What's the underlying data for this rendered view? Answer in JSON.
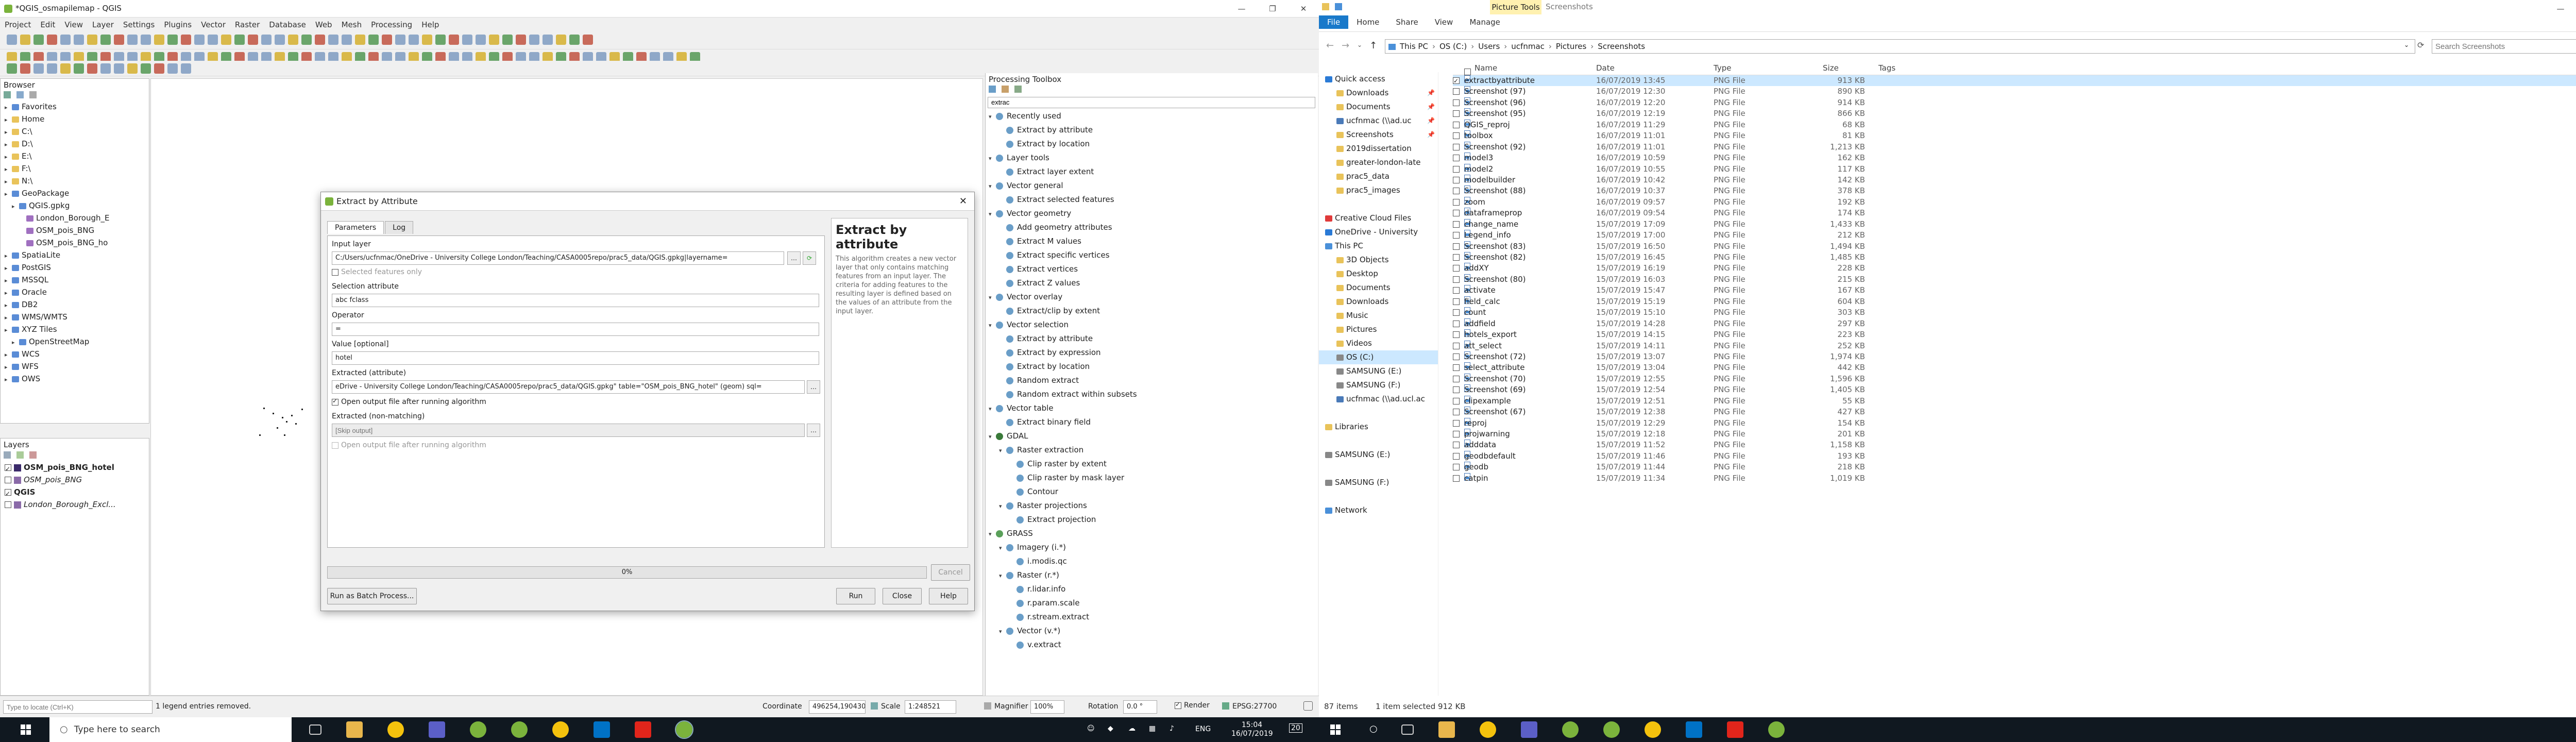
{
  "qgis": {
    "title": "*QGIS_osmapilemap - QGIS",
    "menu": [
      "Project",
      "Edit",
      "View",
      "Layer",
      "Settings",
      "Plugins",
      "Vector",
      "Raster",
      "Database",
      "Web",
      "Mesh",
      "Processing",
      "Help"
    ],
    "browser_title": "Browser",
    "browser_items": [
      {
        "label": "Favorites",
        "indent": 1,
        "icon": "star-icon"
      },
      {
        "label": "Home",
        "indent": 1,
        "icon": "folder-icon"
      },
      {
        "label": "C:\\",
        "indent": 1,
        "icon": "folder-icon"
      },
      {
        "label": "D:\\",
        "indent": 1,
        "icon": "folder-icon"
      },
      {
        "label": "E:\\",
        "indent": 1,
        "icon": "folder-icon"
      },
      {
        "label": "F:\\",
        "indent": 1,
        "icon": "folder-icon"
      },
      {
        "label": "N:\\",
        "indent": 1,
        "icon": "folder-icon"
      },
      {
        "label": "GeoPackage",
        "indent": 1,
        "icon": "geopackage-icon"
      },
      {
        "label": "QGIS.gpkg",
        "indent": 2,
        "icon": "geopackage-icon"
      },
      {
        "label": "London_Borough_E",
        "indent": 3,
        "icon": "polygon-layer-icon"
      },
      {
        "label": "OSM_pois_BNG",
        "indent": 3,
        "icon": "point-layer-icon"
      },
      {
        "label": "OSM_pois_BNG_ho",
        "indent": 3,
        "icon": "point-layer-icon"
      },
      {
        "label": "SpatiaLite",
        "indent": 1,
        "icon": "spatialite-icon"
      },
      {
        "label": "PostGIS",
        "indent": 1,
        "icon": "postgis-icon"
      },
      {
        "label": "MSSQL",
        "indent": 1,
        "icon": "mssql-icon"
      },
      {
        "label": "Oracle",
        "indent": 1,
        "icon": "oracle-icon"
      },
      {
        "label": "DB2",
        "indent": 1,
        "icon": "db2-icon"
      },
      {
        "label": "WMS/WMTS",
        "indent": 1,
        "icon": "wms-icon"
      },
      {
        "label": "XYZ Tiles",
        "indent": 1,
        "icon": "xyz-icon"
      },
      {
        "label": "OpenStreetMap",
        "indent": 2,
        "icon": "globe-icon"
      },
      {
        "label": "WCS",
        "indent": 1,
        "icon": "wcs-icon"
      },
      {
        "label": "WFS",
        "indent": 1,
        "icon": "wfs-icon"
      },
      {
        "label": "OWS",
        "indent": 1,
        "icon": "ows-icon"
      }
    ],
    "layers_title": "Layers",
    "layers": [
      {
        "label": "OSM_pois_BNG_hotel",
        "checked": true,
        "style": "bold"
      },
      {
        "label": "OSM_pois_BNG",
        "checked": false,
        "style": "italic"
      },
      {
        "label": "QGIS",
        "checked": true,
        "style": "bold-group"
      },
      {
        "label": "London_Borough_Excl...",
        "checked": false,
        "style": "italic"
      }
    ],
    "locate_placeholder": "Type to locate (Ctrl+K)",
    "status_message": "1 legend entries removed.",
    "coordinate_label": "Coordinate",
    "coordinate_value": "496254,190430",
    "scale_label": "Scale",
    "scale_value": "1:248521",
    "magnifier_label": "Magnifier",
    "magnifier_value": "100%",
    "rotation_label": "Rotation",
    "rotation_value": "0.0 °",
    "render_label": "Render",
    "crs": "EPSG:27700"
  },
  "dialog": {
    "title": "Extract by Attribute",
    "tabs": [
      "Parameters",
      "Log"
    ],
    "input_layer_label": "Input layer",
    "input_layer_value": "C:/Users/ucfnmac/OneDrive - University College London/Teaching/CASA0005repo/prac5_data/QGIS.gpkg|layername=",
    "selected_only_label": "Selected features only",
    "selection_attr_label": "Selection attribute",
    "selection_attr_value": "abc fclass",
    "operator_label": "Operator",
    "operator_value": "=",
    "value_label": "Value [optional]",
    "value_value": "hotel",
    "extracted_label": "Extracted (attribute)",
    "extracted_value": "eDrive - University College London/Teaching/CASA0005repo/prac5_data/QGIS.gpkg\" table=\"OSM_pois_BNG_hotel\" (geom) sql=",
    "open_after_label": "Open output file after running algorithm",
    "nonmatching_label": "Extracted (non-matching)",
    "nonmatching_placeholder": "[Skip output]",
    "open_after2_label": "Open output file after running algorithm",
    "progress_text": "0%",
    "progress": 0,
    "cancel": "Cancel",
    "batch": "Run as Batch Process...",
    "run": "Run",
    "close": "Close",
    "help": "Help",
    "help_title": "Extract by attribute",
    "help_text": "This algorithm creates a new vector layer that only contains matching features from an input layer. The criteria for adding features to the resulting layer is defined based on the values of an attribute from the input layer."
  },
  "toolbox": {
    "title": "Processing Toolbox",
    "search_value": "extrac",
    "items": [
      {
        "label": "Recently used",
        "level": 0,
        "type": "group"
      },
      {
        "label": "Extract by attribute",
        "level": 1,
        "type": "alg"
      },
      {
        "label": "Extract by location",
        "level": 1,
        "type": "alg"
      },
      {
        "label": "Layer tools",
        "level": 0,
        "type": "group"
      },
      {
        "label": "Extract layer extent",
        "level": 1,
        "type": "alg"
      },
      {
        "label": "Vector general",
        "level": 0,
        "type": "group"
      },
      {
        "label": "Extract selected features",
        "level": 1,
        "type": "alg"
      },
      {
        "label": "Vector geometry",
        "level": 0,
        "type": "group"
      },
      {
        "label": "Add geometry attributes",
        "level": 1,
        "type": "alg"
      },
      {
        "label": "Extract M values",
        "level": 1,
        "type": "alg"
      },
      {
        "label": "Extract specific vertices",
        "level": 1,
        "type": "alg"
      },
      {
        "label": "Extract vertices",
        "level": 1,
        "type": "alg"
      },
      {
        "label": "Extract Z values",
        "level": 1,
        "type": "alg"
      },
      {
        "label": "Vector overlay",
        "level": 0,
        "type": "group"
      },
      {
        "label": "Extract/clip by extent",
        "level": 1,
        "type": "alg"
      },
      {
        "label": "Vector selection",
        "level": 0,
        "type": "group"
      },
      {
        "label": "Extract by attribute",
        "level": 1,
        "type": "alg"
      },
      {
        "label": "Extract by expression",
        "level": 1,
        "type": "alg"
      },
      {
        "label": "Extract by location",
        "level": 1,
        "type": "alg"
      },
      {
        "label": "Random extract",
        "level": 1,
        "type": "alg"
      },
      {
        "label": "Random extract within subsets",
        "level": 1,
        "type": "alg"
      },
      {
        "label": "Vector table",
        "level": 0,
        "type": "group"
      },
      {
        "label": "Extract binary field",
        "level": 1,
        "type": "alg"
      },
      {
        "label": "GDAL",
        "level": 0,
        "type": "provider"
      },
      {
        "label": "Raster extraction",
        "level": 1,
        "type": "group"
      },
      {
        "label": "Clip raster by extent",
        "level": 2,
        "type": "alg"
      },
      {
        "label": "Clip raster by mask layer",
        "level": 2,
        "type": "alg"
      },
      {
        "label": "Contour",
        "level": 2,
        "type": "alg"
      },
      {
        "label": "Raster projections",
        "level": 1,
        "type": "group"
      },
      {
        "label": "Extract projection",
        "level": 2,
        "type": "alg"
      },
      {
        "label": "GRASS",
        "level": 0,
        "type": "provider"
      },
      {
        "label": "Imagery (i.*)",
        "level": 1,
        "type": "group"
      },
      {
        "label": "i.modis.qc",
        "level": 2,
        "type": "alg"
      },
      {
        "label": "Raster (r.*)",
        "level": 1,
        "type": "group"
      },
      {
        "label": "r.lidar.info",
        "level": 2,
        "type": "alg"
      },
      {
        "label": "r.param.scale",
        "level": 2,
        "type": "alg"
      },
      {
        "label": "r.stream.extract",
        "level": 2,
        "type": "alg"
      },
      {
        "label": "Vector (v.*)",
        "level": 1,
        "type": "group"
      },
      {
        "label": "v.extract",
        "level": 2,
        "type": "alg"
      }
    ]
  },
  "explorer": {
    "context_tab": "Picture Tools",
    "folder_title": "Screenshots",
    "ribbon_tabs": [
      "File",
      "Home",
      "Share",
      "View",
      "Manage"
    ],
    "path": [
      "This PC",
      "OS (C:)",
      "Users",
      "ucfnmac",
      "Pictures",
      "Screenshots"
    ],
    "search_placeholder": "Search Screenshots",
    "nav": [
      {
        "label": "Quick access",
        "icon": "star-icon",
        "indent": 0,
        "pin": false
      },
      {
        "label": "Downloads",
        "icon": "download-folder-icon",
        "indent": 1,
        "pin": true
      },
      {
        "label": "Documents",
        "icon": "document-folder-icon",
        "indent": 1,
        "pin": true
      },
      {
        "label": "ucfnmac (\\\\ad.uc",
        "icon": "network-drive-icon",
        "indent": 1,
        "pin": true
      },
      {
        "label": "Screenshots",
        "icon": "folder-icon",
        "indent": 1,
        "pin": true
      },
      {
        "label": "2019dissertation",
        "icon": "folder-icon",
        "indent": 1,
        "pin": false
      },
      {
        "label": "greater-london-late",
        "icon": "folder-icon",
        "indent": 1,
        "pin": false
      },
      {
        "label": "prac5_data",
        "icon": "folder-icon",
        "indent": 1,
        "pin": false
      },
      {
        "label": "prac5_images",
        "icon": "folder-icon",
        "indent": 1,
        "pin": false
      },
      {
        "label": "",
        "icon": "",
        "indent": 0,
        "pin": false
      },
      {
        "label": "Creative Cloud Files",
        "icon": "creative-cloud-icon",
        "indent": 0,
        "pin": false
      },
      {
        "label": "OneDrive - University",
        "icon": "onedrive-icon",
        "indent": 0,
        "pin": false
      },
      {
        "label": "This PC",
        "icon": "computer-icon",
        "indent": 0,
        "pin": false
      },
      {
        "label": "3D Objects",
        "icon": "3d-objects-icon",
        "indent": 1,
        "pin": false
      },
      {
        "label": "Desktop",
        "icon": "desktop-folder-icon",
        "indent": 1,
        "pin": false
      },
      {
        "label": "Documents",
        "icon": "document-folder-icon",
        "indent": 1,
        "pin": false
      },
      {
        "label": "Downloads",
        "icon": "download-folder-icon",
        "indent": 1,
        "pin": false
      },
      {
        "label": "Music",
        "icon": "music-folder-icon",
        "indent": 1,
        "pin": false
      },
      {
        "label": "Pictures",
        "icon": "pictures-folder-icon",
        "indent": 1,
        "pin": false
      },
      {
        "label": "Videos",
        "icon": "videos-folder-icon",
        "indent": 1,
        "pin": false
      },
      {
        "label": "OS (C:)",
        "icon": "drive-icon",
        "indent": 1,
        "pin": false,
        "selected": true
      },
      {
        "label": "SAMSUNG (E:)",
        "icon": "drive-icon",
        "indent": 1,
        "pin": false
      },
      {
        "label": "SAMSUNG (F:)",
        "icon": "drive-icon",
        "indent": 1,
        "pin": false
      },
      {
        "label": "ucfnmac (\\\\ad.ucl.ac",
        "icon": "network-drive-icon",
        "indent": 1,
        "pin": false
      },
      {
        "label": "",
        "icon": "",
        "indent": 0,
        "pin": false
      },
      {
        "label": "Libraries",
        "icon": "libraries-icon",
        "indent": 0,
        "pin": false
      },
      {
        "label": "",
        "icon": "",
        "indent": 0,
        "pin": false
      },
      {
        "label": "SAMSUNG (E:)",
        "icon": "drive-icon",
        "indent": 0,
        "pin": false
      },
      {
        "label": "",
        "icon": "",
        "indent": 0,
        "pin": false
      },
      {
        "label": "SAMSUNG (F:)",
        "icon": "drive-icon",
        "indent": 0,
        "pin": false
      },
      {
        "label": "",
        "icon": "",
        "indent": 0,
        "pin": false
      },
      {
        "label": "Network",
        "icon": "network-icon",
        "indent": 0,
        "pin": false
      }
    ],
    "columns": [
      "Name",
      "Date",
      "Type",
      "Size",
      "Tags"
    ],
    "files": [
      [
        "extractbyattribute",
        "16/07/2019 13:45",
        "PNG File",
        "913 KB"
      ],
      [
        "Screenshot (97)",
        "16/07/2019 12:30",
        "PNG File",
        "890 KB"
      ],
      [
        "Screenshot (96)",
        "16/07/2019 12:20",
        "PNG File",
        "914 KB"
      ],
      [
        "Screenshot (95)",
        "16/07/2019 12:19",
        "PNG File",
        "866 KB"
      ],
      [
        "QGIS_reproj",
        "16/07/2019 11:29",
        "PNG File",
        "68 KB"
      ],
      [
        "toolbox",
        "16/07/2019 11:01",
        "PNG File",
        "81 KB"
      ],
      [
        "Screenshot (92)",
        "16/07/2019 11:01",
        "PNG File",
        "1,213 KB"
      ],
      [
        "model3",
        "16/07/2019 10:59",
        "PNG File",
        "162 KB"
      ],
      [
        "model2",
        "16/07/2019 10:55",
        "PNG File",
        "117 KB"
      ],
      [
        "modelbuilder",
        "16/07/2019 10:42",
        "PNG File",
        "142 KB"
      ],
      [
        "Screenshot (88)",
        "16/07/2019 10:37",
        "PNG File",
        "378 KB"
      ],
      [
        "zoom",
        "16/07/2019 09:57",
        "PNG File",
        "192 KB"
      ],
      [
        "dataframeprop",
        "16/07/2019 09:54",
        "PNG File",
        "174 KB"
      ],
      [
        "change_name",
        "15/07/2019 17:09",
        "PNG File",
        "1,433 KB"
      ],
      [
        "Legend_info",
        "15/07/2019 17:00",
        "PNG File",
        "212 KB"
      ],
      [
        "Screenshot (83)",
        "15/07/2019 16:50",
        "PNG File",
        "1,494 KB"
      ],
      [
        "Screenshot (82)",
        "15/07/2019 16:45",
        "PNG File",
        "1,485 KB"
      ],
      [
        "addXY",
        "15/07/2019 16:19",
        "PNG File",
        "228 KB"
      ],
      [
        "Screenshot (80)",
        "15/07/2019 16:03",
        "PNG File",
        "215 KB"
      ],
      [
        "activate",
        "15/07/2019 15:47",
        "PNG File",
        "167 KB"
      ],
      [
        "field_calc",
        "15/07/2019 15:19",
        "PNG File",
        "604 KB"
      ],
      [
        "count",
        "15/07/2019 15:10",
        "PNG File",
        "303 KB"
      ],
      [
        "addfield",
        "15/07/2019 14:28",
        "PNG File",
        "297 KB"
      ],
      [
        "hotels_export",
        "15/07/2019 14:15",
        "PNG File",
        "223 KB"
      ],
      [
        "att_select",
        "15/07/2019 14:11",
        "PNG File",
        "252 KB"
      ],
      [
        "Screenshot (72)",
        "15/07/2019 13:07",
        "PNG File",
        "1,974 KB"
      ],
      [
        "select_attribute",
        "15/07/2019 13:04",
        "PNG File",
        "442 KB"
      ],
      [
        "Screenshot (70)",
        "15/07/2019 12:55",
        "PNG File",
        "1,596 KB"
      ],
      [
        "Screenshot (69)",
        "15/07/2019 12:54",
        "PNG File",
        "1,405 KB"
      ],
      [
        "clipexample",
        "15/07/2019 12:51",
        "PNG File",
        "55 KB"
      ],
      [
        "Screenshot (67)",
        "15/07/2019 12:38",
        "PNG File",
        "427 KB"
      ],
      [
        "reproj",
        "15/07/2019 12:29",
        "PNG File",
        "154 KB"
      ],
      [
        "projwarning",
        "15/07/2019 12:18",
        "PNG File",
        "201 KB"
      ],
      [
        "adddata",
        "15/07/2019 11:52",
        "PNG File",
        "1,158 KB"
      ],
      [
        "geodbdefault",
        "15/07/2019 11:46",
        "PNG File",
        "193 KB"
      ],
      [
        "geodb",
        "15/07/2019 11:44",
        "PNG File",
        "218 KB"
      ],
      [
        "catpin",
        "15/07/2019 11:34",
        "PNG File",
        "1,019 KB"
      ]
    ],
    "item_count": "87 items",
    "selection_status": "1 item selected  912 KB"
  },
  "taskbar": {
    "search_placeholder": "Type here to search",
    "lang": "ENG",
    "time": "15:04",
    "date": "16/07/2019",
    "notif_count": "20"
  },
  "colors": {
    "taskbar": "#101820",
    "selection": "#cce8ff",
    "accent": "#0078d7",
    "picture_tools": "#fff1b0"
  }
}
